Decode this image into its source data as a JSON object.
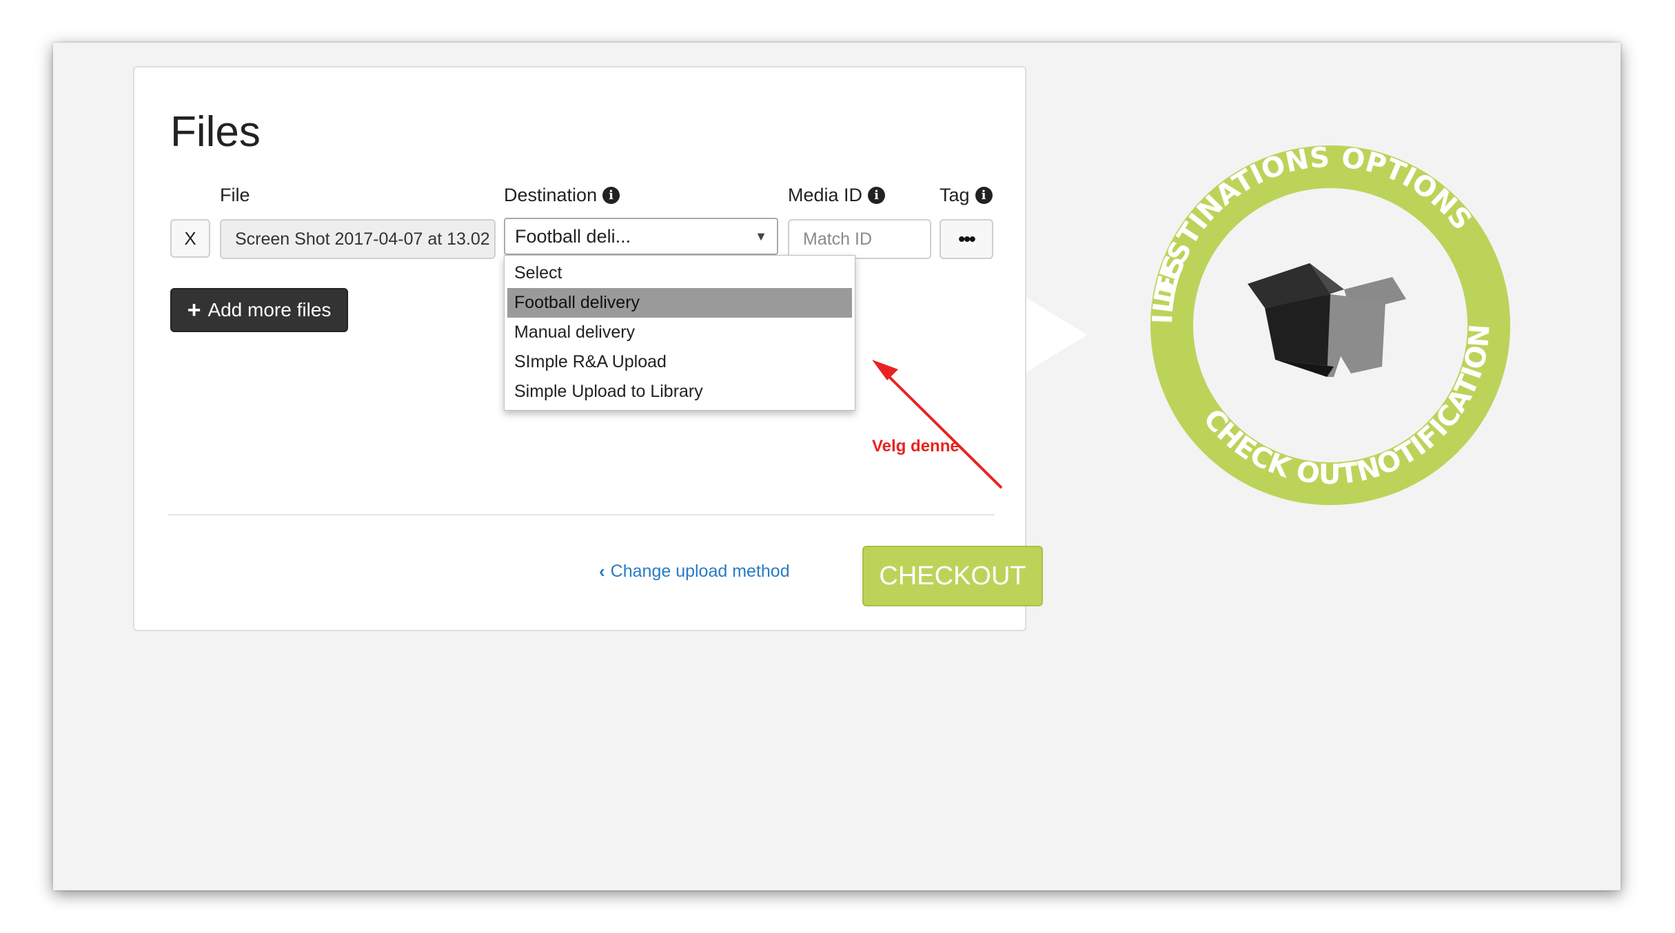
{
  "page": {
    "title": "Files"
  },
  "columns": {
    "file": "File",
    "destination": "Destination",
    "media_id": "Media ID",
    "tag": "Tag"
  },
  "row": {
    "remove_label": "X",
    "file_name": "Screen Shot 2017-04-07 at 13.02",
    "destination_value": "Football deli...",
    "media_id_placeholder": "Match ID",
    "tag_label": "•••"
  },
  "dropdown": {
    "options": [
      "Select",
      "Football delivery",
      "Manual delivery",
      "SImple R&A Upload",
      "Simple Upload to Library"
    ],
    "highlighted": "Football delivery"
  },
  "annotation": {
    "text": "Velg denne",
    "color": "#e8231f"
  },
  "actions": {
    "add_files": "Add more files",
    "change_method": "Change upload method",
    "checkout": "CHECKOUT"
  },
  "logo": {
    "ring_labels": [
      "DESTINATIONS",
      "OPTIONS",
      "NOTIFICATIONS",
      "CHECK OUT",
      "FILES"
    ],
    "ring_color": "#bcd35a",
    "icon": "open-box-icon"
  },
  "colors": {
    "accent": "#bcd35a",
    "link": "#2a7ac4",
    "dark_button": "#333333"
  }
}
